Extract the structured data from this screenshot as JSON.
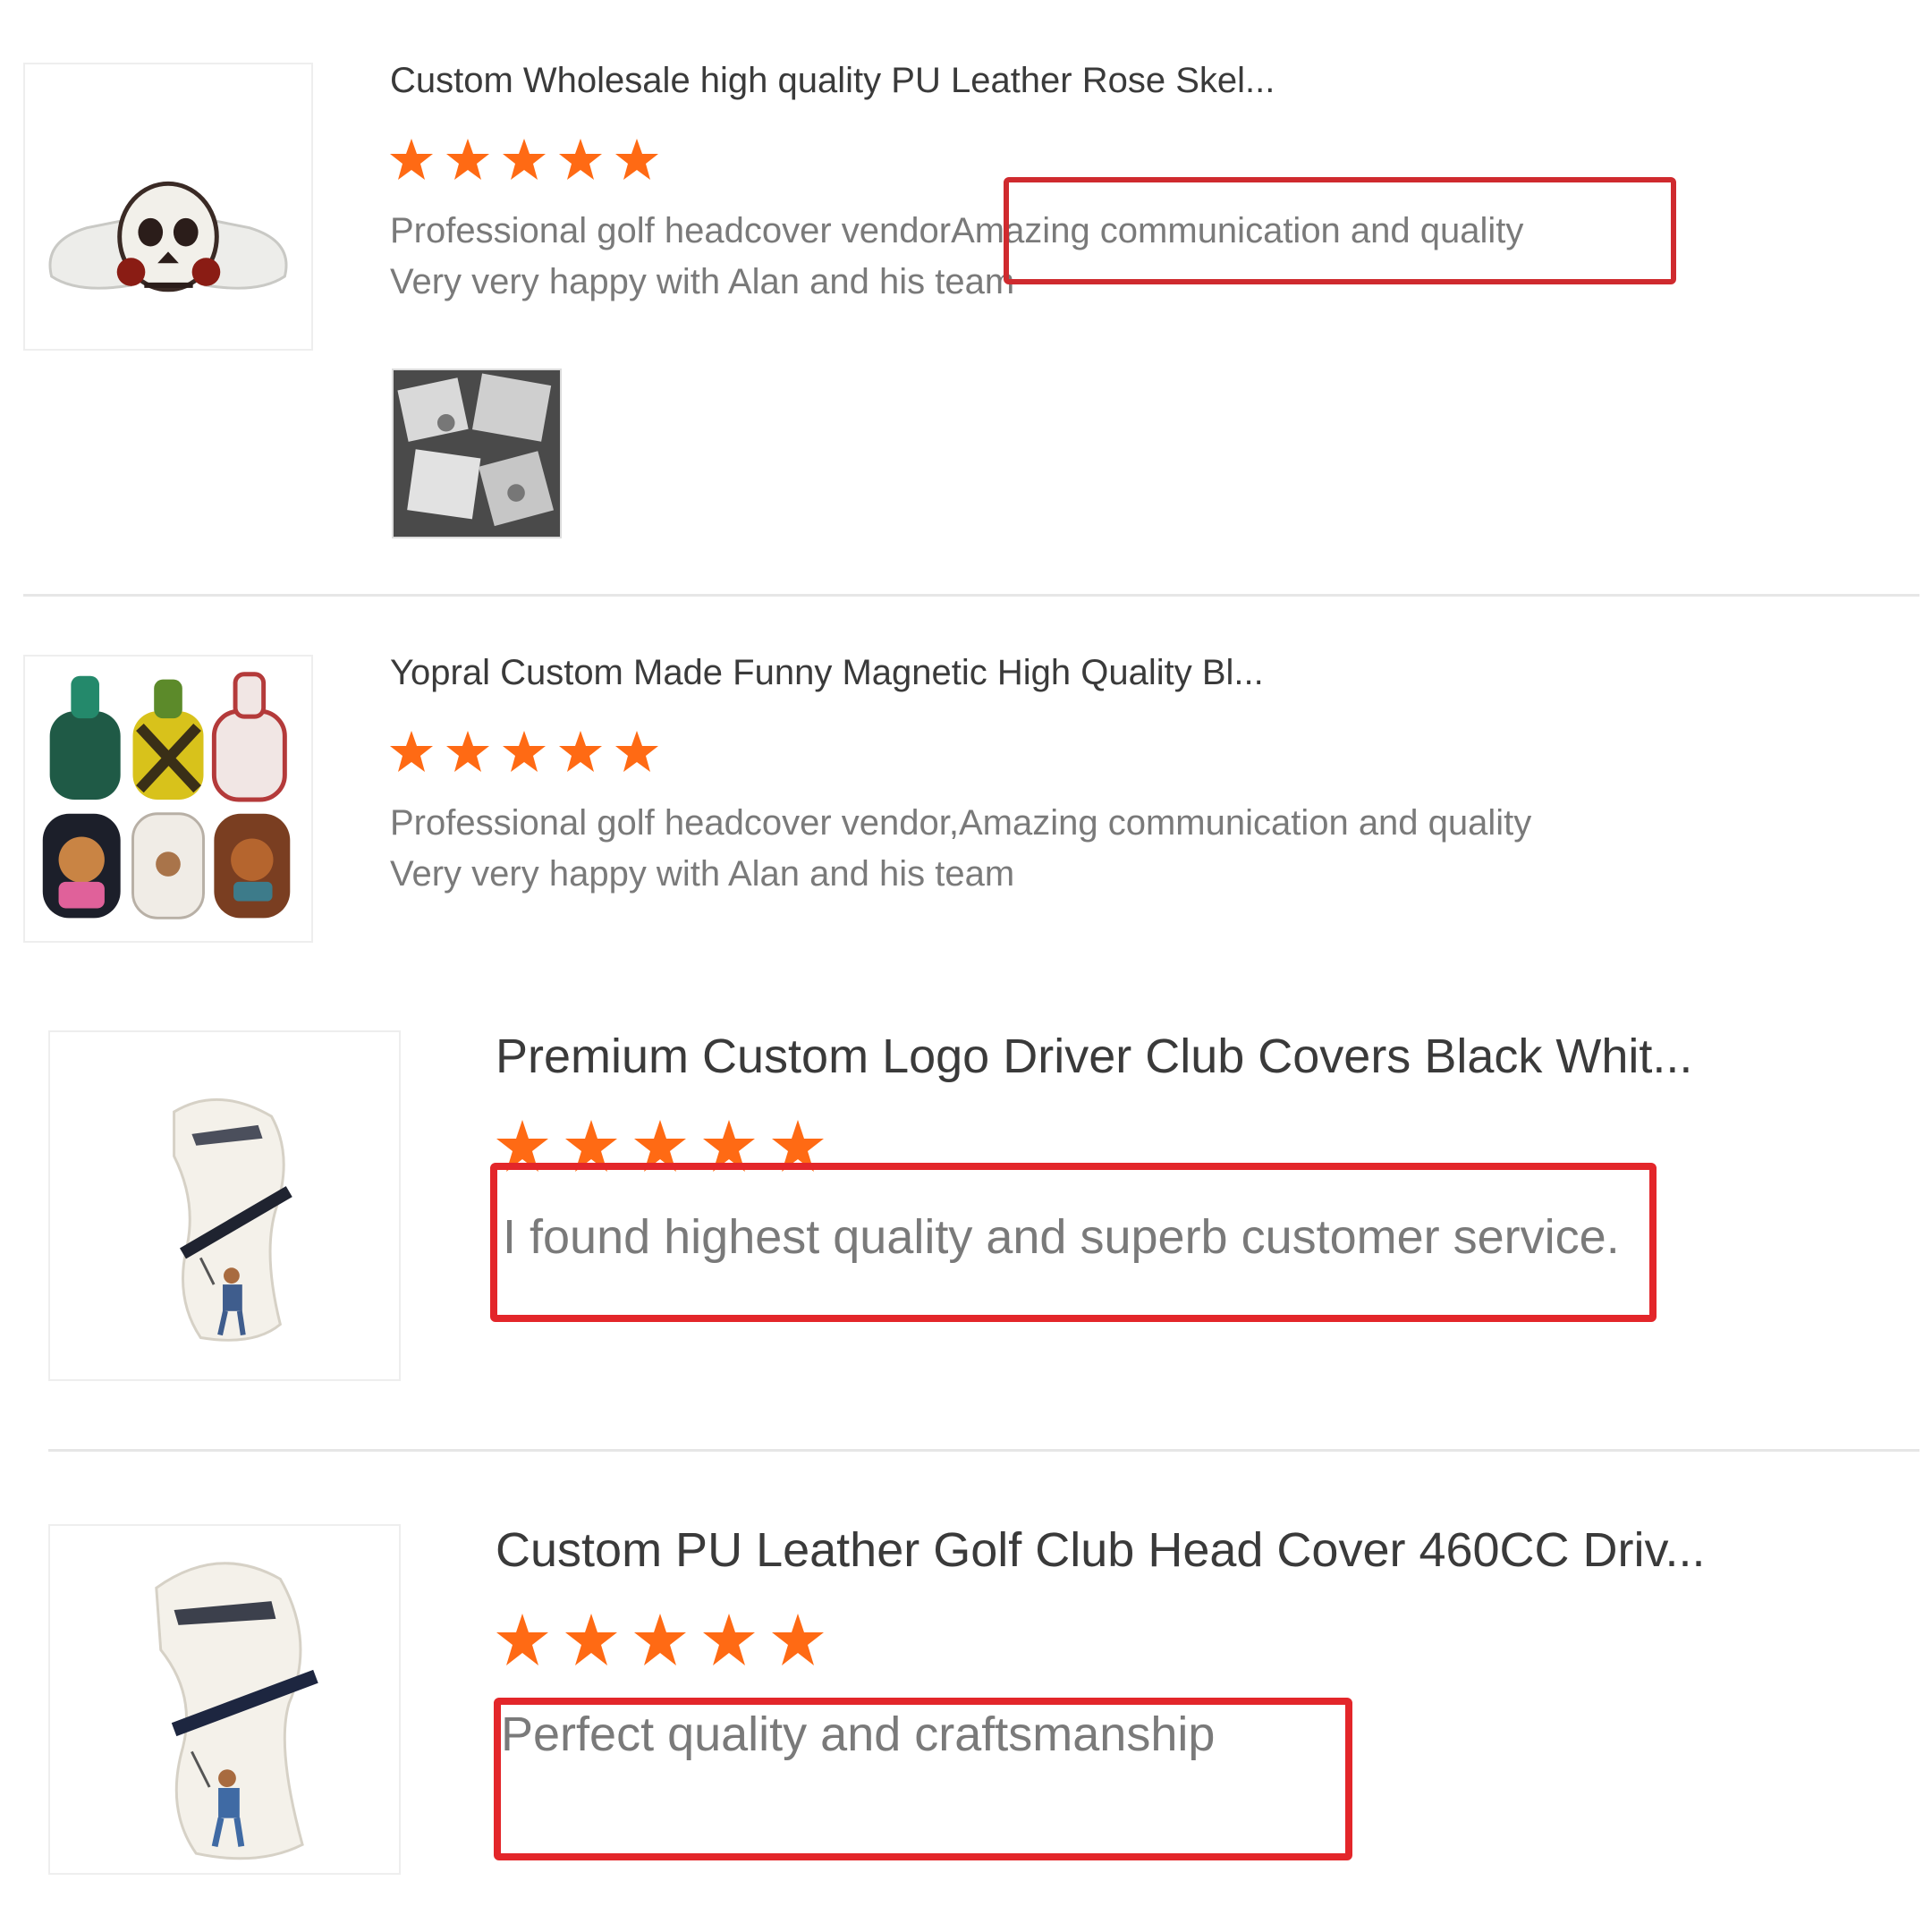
{
  "colors": {
    "star": "#ff6a14",
    "highlight": "#e3262a",
    "divider": "#e6e6e6"
  },
  "reviews": [
    {
      "title": "Custom Wholesale high quality PU Leather Rose Skel...",
      "rating": 5,
      "text_line1_a": "Professional golf headcover vendor",
      "text_line1_b": "Amazing communication and quality",
      "text_line2": "Very very happy with Alan and his team",
      "image_icon": "skull-headcover-image",
      "photo_icon": "package-photo"
    },
    {
      "title": "Yopral Custom Made Funny Magnetic High Quality Bl...",
      "rating": 5,
      "text_line1": "Professional golf headcover vendor,Amazing communication and quality",
      "text_line2": "Very very happy with Alan and his team",
      "image_icon": "magnetic-headcovers-image"
    },
    {
      "title": "Premium Custom Logo Driver Club Covers Black Whit...",
      "rating": 5,
      "text": "I found highest quality and superb customer service.",
      "image_icon": "driver-cover-image"
    },
    {
      "title": "Custom PU Leather Golf Club Head Cover 460CC Driv...",
      "rating": 5,
      "text": "Perfect quality and craftsmanship",
      "image_icon": "driver-cover-image"
    }
  ]
}
